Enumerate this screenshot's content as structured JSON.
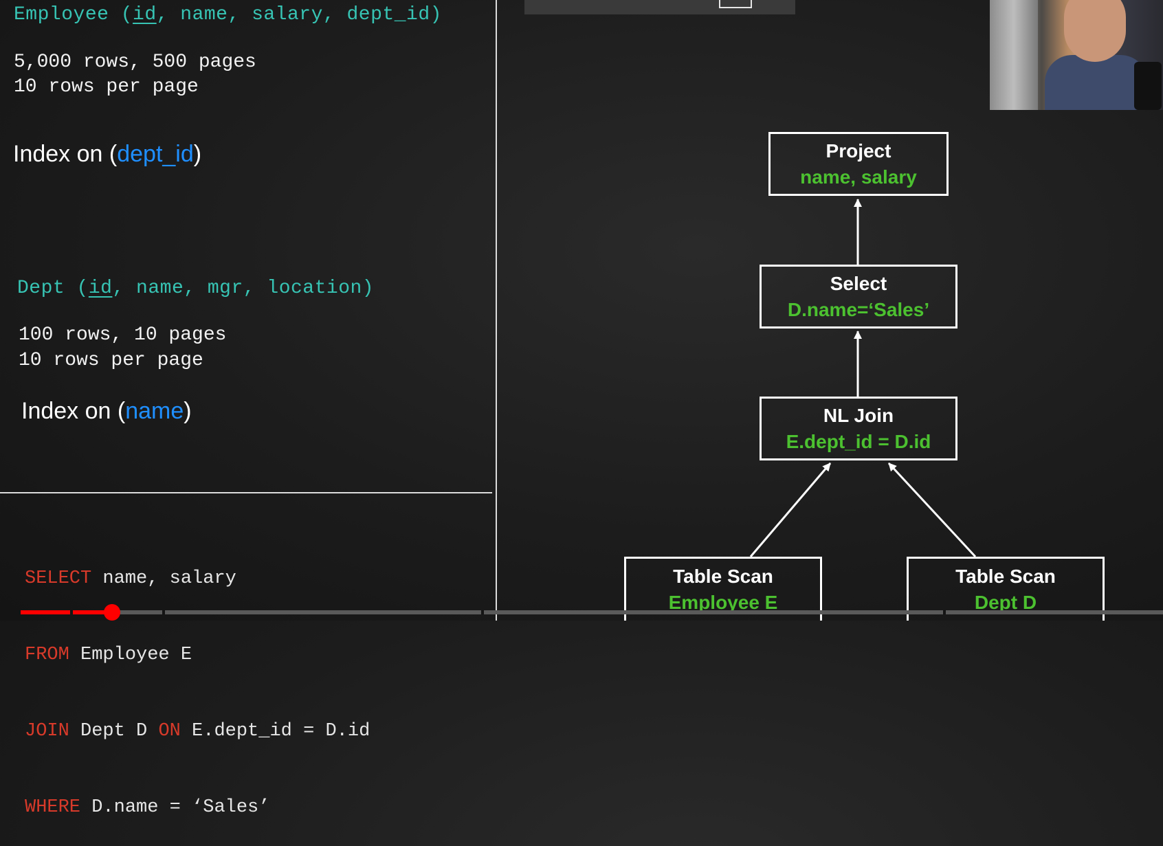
{
  "employee": {
    "table": "Employee",
    "open": "(",
    "key": "id",
    "rest": ", name, salary, dept_id)",
    "stats": [
      "5,000 rows, 500 pages",
      "10 rows per page"
    ],
    "index_prefix": "Index on (",
    "index_col": "dept_id",
    "index_suffix": ")"
  },
  "dept": {
    "table": "Dept",
    "open": "(",
    "key": "id",
    "rest": ", name, mgr, location)",
    "stats": [
      "100 rows, 10 pages",
      "10 rows per page"
    ],
    "index_prefix": "Index on (",
    "index_col": "name",
    "index_suffix": ")"
  },
  "query": {
    "lines": [
      {
        "keyword": "SELECT",
        "text": " name, salary"
      },
      {
        "keyword": "FROM",
        "text": " Employee E"
      },
      {
        "keyword": "JOIN",
        "text": " Dept D ",
        "keyword2": "ON",
        "text2": " E.dept_id = D.id"
      },
      {
        "keyword": "WHERE",
        "text": " D.name = ‘Sales’"
      }
    ]
  },
  "plan": {
    "project": {
      "op": "Project",
      "arg": "name, salary"
    },
    "select": {
      "op": "Select",
      "arg": "D.name=‘Sales’"
    },
    "join": {
      "op": "NL Join",
      "arg": "E.dept_id = D.id"
    },
    "scan_left": {
      "op": "Table Scan",
      "arg": "Employee E"
    },
    "scan_right": {
      "op": "Table Scan",
      "arg": "Dept D"
    }
  },
  "colors": {
    "schema": "#37c4b4",
    "index_column": "#1f8fff",
    "sql_keyword": "#d83a2a",
    "plan_argument": "#4cc130",
    "progress": "#ff0000"
  },
  "video": {
    "progress": 0.08
  }
}
